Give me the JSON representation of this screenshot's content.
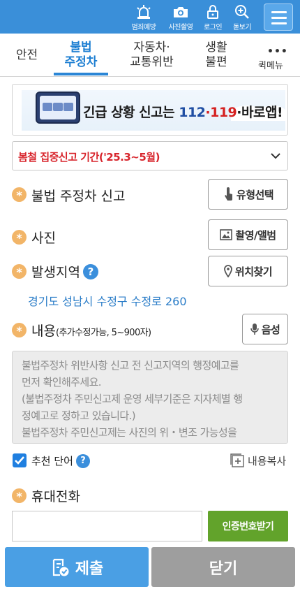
{
  "header": {
    "items": [
      {
        "label": "범죄예방",
        "icon": "siren-icon"
      },
      {
        "label": "사진촬영",
        "icon": "camera-icon"
      },
      {
        "label": "로그인",
        "icon": "lock-icon"
      },
      {
        "label": "돋보기",
        "icon": "magnifier-plus-icon"
      }
    ],
    "menu_icon": "hamburger-icon",
    "color": "#3a8fd9"
  },
  "tabs": [
    {
      "line1": "안전",
      "line2": "",
      "active": false
    },
    {
      "line1": "불법",
      "line2": "주정차",
      "active": true
    },
    {
      "line1": "자동차·",
      "line2": "교통위반",
      "active": false
    },
    {
      "line1": "생활",
      "line2": "불편",
      "active": false
    }
  ],
  "quick_menu": {
    "dots": "•••",
    "label": "퀵메뉴"
  },
  "banner": {
    "prefix": "긴급 상황 신고는 ",
    "n112": "112",
    "dot": "·",
    "n119": "119",
    "suffix": "·바로앱!"
  },
  "notice": {
    "text": "봄철 집중신고 기간('25.3~5월)",
    "icon": "chevron-down-icon"
  },
  "form": {
    "report_label": "불법 주정차 신고",
    "type_button": "유형선택",
    "photo_label": "사진",
    "photo_button": "촬영/앨범",
    "location_label": "발생지역",
    "location_help": "?",
    "location_button": "위치찾기",
    "address": "경기도 성남시 수정구 수정로 260",
    "content_label": "내용",
    "content_hint": "(추가수정가능, 5~900자)",
    "voice_button": "음성",
    "content_lines": [
      "불법주정차 위반사항 신고 전 신고지역의 행정예고를",
      "먼저 확인해주세요.",
      "(불법주정차 주민신고제 운영 세부기준은 지자체별 행",
      "정예고로 정하고 있습니다.)",
      "불법주정차 주민신고제는 사진의 위・변조 가능성을"
    ],
    "recommend_label": "추천 단어",
    "recommend_help": "?",
    "recommend_checked": true,
    "copy_button": "내용복사",
    "phone_label": "휴대전화",
    "phone_value": "",
    "verify_button": "인증번호받기",
    "required_mark": "*"
  },
  "footer": {
    "submit": "제출",
    "close": "닫기"
  }
}
